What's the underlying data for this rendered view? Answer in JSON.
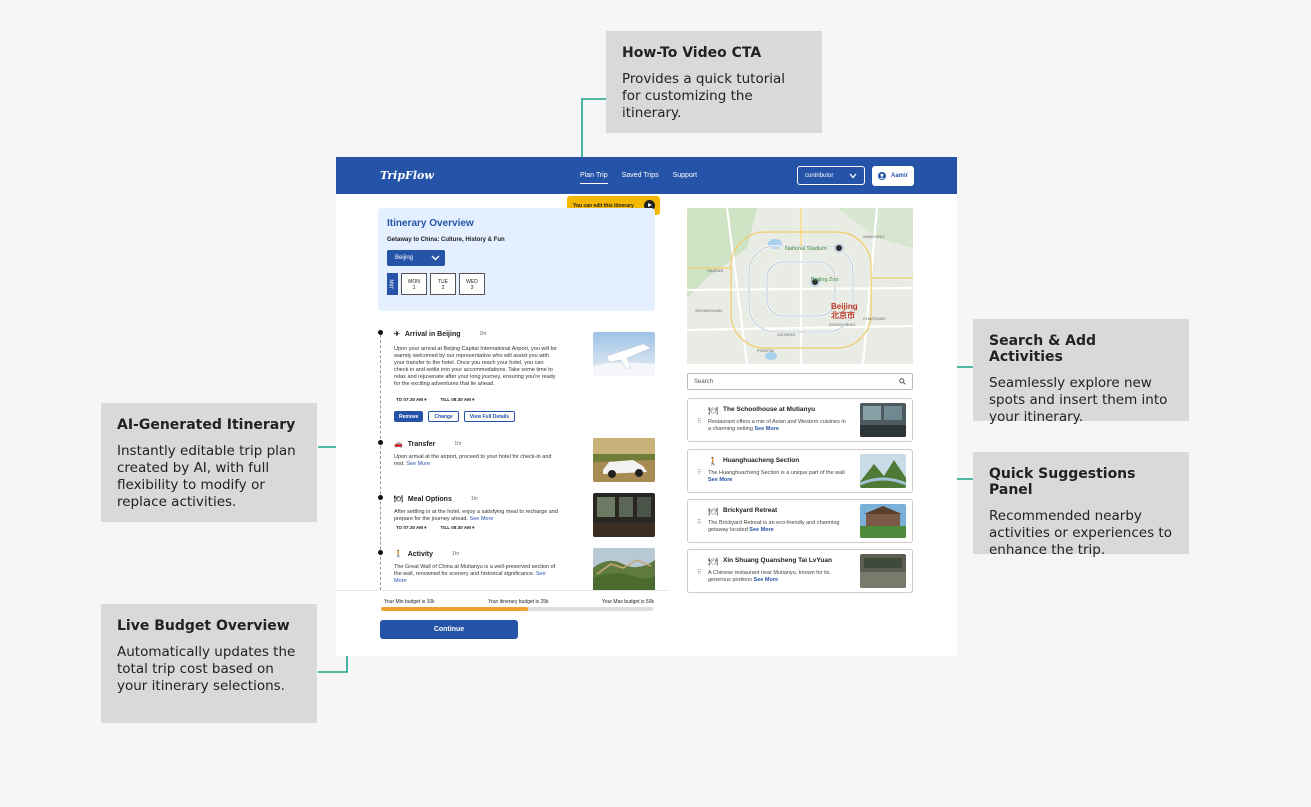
{
  "callouts": {
    "howto": {
      "title": "How-To Video CTA",
      "body": "Provides a quick tutorial for customizing the itinerary."
    },
    "ai": {
      "title": "AI-Generated Itinerary",
      "body": "Instantly editable trip plan created by AI, with full flexibility to modify or replace activities."
    },
    "budget": {
      "title": "Live Budget Overview",
      "body": "Automatically updates the total trip cost based on your itinerary selections."
    },
    "search": {
      "title": "Search & Add Activities",
      "body": "Seamlessly explore new spots and insert them into your itinerary."
    },
    "suggestions": {
      "title": "Quick Suggestions Panel",
      "body": "Recommended nearby activities or experiences to enhance the trip."
    }
  },
  "nav": {
    "logo": "TripFlow",
    "links": [
      "Plan Trip",
      "Saved Trips",
      "Support"
    ],
    "role": "contributor",
    "user": "Aamir",
    "edit_pill": "You can edit this itinerary"
  },
  "overview": {
    "title": "Itinerary Overview",
    "subtitle": "Getaway to China: Culture, History & Fun",
    "city": "Beijing",
    "month": "JAN",
    "days": [
      {
        "dow": "MON",
        "num": "1"
      },
      {
        "dow": "TUE",
        "num": "2"
      },
      {
        "dow": "WED",
        "num": "3"
      }
    ]
  },
  "activities": [
    {
      "title": "Arrival in Beijing",
      "duration": "1hr",
      "desc": "Upon your arrival at Beijing Capital International Airport, you will be warmly welcomed by our representative who will assist you with your transfer to the hotel. Once you reach your hotel, you can check in and settle into your accommodations. Take some time to relax and rejuvenate after your long journey, ensuring you're ready for the exciting adventures that lie ahead.",
      "more": "",
      "to": "07:30 AM",
      "till": "08:30 AM",
      "icon": "✈"
    },
    {
      "title": "Transfer",
      "duration": "1hr",
      "desc": "Upon arrival at the airport, proceed to your hotel for check-in and rest.",
      "more": "See More",
      "to": "",
      "till": "",
      "icon": "🚗"
    },
    {
      "title": "Meal Options",
      "duration": "1hr",
      "desc": "After settling in at the hotel, enjoy a satisfying meal to recharge and prepare for the journey ahead.",
      "more": "See More",
      "to": "07:30 AM",
      "till": "08:30 AM",
      "icon": "🍽"
    },
    {
      "title": "Activity",
      "duration": "1hr",
      "desc": "The Great Wall of China at Mutianyu is a well-preserved section of the wall, renowned for scenery and historical significance.",
      "more": "See More",
      "to": "",
      "till": "",
      "icon": "🚶"
    }
  ],
  "labels": {
    "to": "TO",
    "till": "TILL",
    "remove": "Remove",
    "change": "Change",
    "view": "View Full Details"
  },
  "budget": {
    "min": "Your Min budget is 10k",
    "itinerary": "Your itinerary budget is 25k",
    "max": "Your Max budget is 50k",
    "progress": 0.54,
    "continue": "Continue"
  },
  "map": {
    "labels": [
      "National Stadium",
      "Beijing Zoo",
      "Beijing",
      "北京市",
      "DONGCHENG",
      "HAIDIAN",
      "CHAOYANG",
      "XICHENG",
      "FENGTAI",
      "WANGJING",
      "SHIJINGSHAN"
    ]
  },
  "search": {
    "placeholder": "Search"
  },
  "suggestions": [
    {
      "name": "The Schoolhouse at Mutianyu",
      "desc": "Restaurant offers a mix of Asian and Western cuisines in a charming setting",
      "more": "See More",
      "icon": "🍽"
    },
    {
      "name": "Huanghuacheng Section",
      "desc": "The Huanghuacheng Section is a unique part of the wall",
      "more": "See More",
      "icon": "🚶"
    },
    {
      "name": "Brickyard Retreat",
      "desc": "The Brickyard Retreat is an eco-friendly and charming getaway located",
      "more": "See More",
      "icon": "🍽"
    },
    {
      "name": "Xin Shuang Quansheng Tai LvYuan",
      "desc": "A Chinese restaurant near Mutianyu, known for its generous portions",
      "more": "See More",
      "icon": "🍽"
    }
  ],
  "colors": {
    "brand": "#2553a8",
    "accent": "#f4b800",
    "connector": "#1aa38c",
    "callout_bg": "#d9d9d9"
  }
}
